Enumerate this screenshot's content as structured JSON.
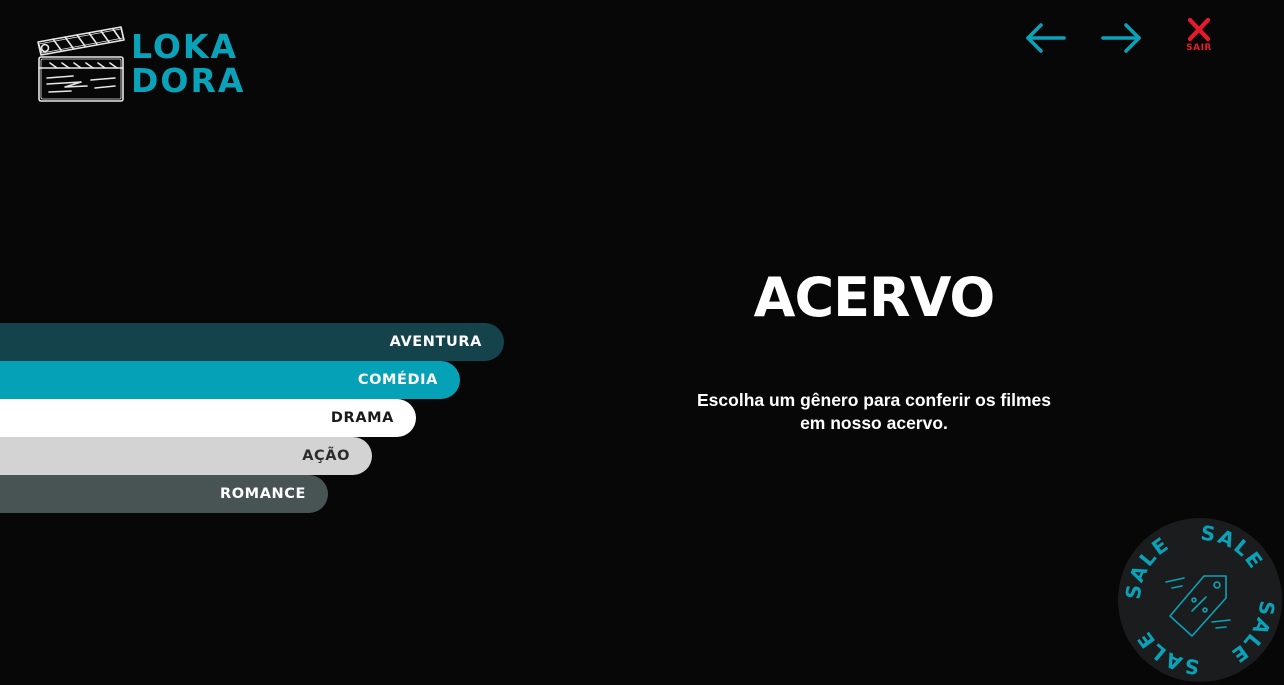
{
  "brand": {
    "line1": "LOKA",
    "line2": "DORA",
    "color": "#0aa2b8"
  },
  "nav": {
    "back_icon": "arrow-left-icon",
    "next_icon": "arrow-right-icon",
    "exit_icon": "close-icon",
    "exit_label": "SAIR",
    "arrow_color": "#0aa2b8",
    "exit_color": "#e8192c"
  },
  "genres": [
    {
      "label": "AVENTURA",
      "color": "#14434b"
    },
    {
      "label": "COMÉDIA",
      "color": "#05a1b6"
    },
    {
      "label": "DRAMA",
      "color": "#ffffff"
    },
    {
      "label": "AÇÃO",
      "color": "#d3d3d3"
    },
    {
      "label": "ROMANCE",
      "color": "#485353"
    }
  ],
  "main": {
    "title": "ACERVO",
    "description_line1": "Escolha um gênero para conferir os filmes",
    "description_line2": "em nosso acervo."
  },
  "sale_badge": {
    "text": "SALE",
    "icon": "price-tag-icon"
  }
}
